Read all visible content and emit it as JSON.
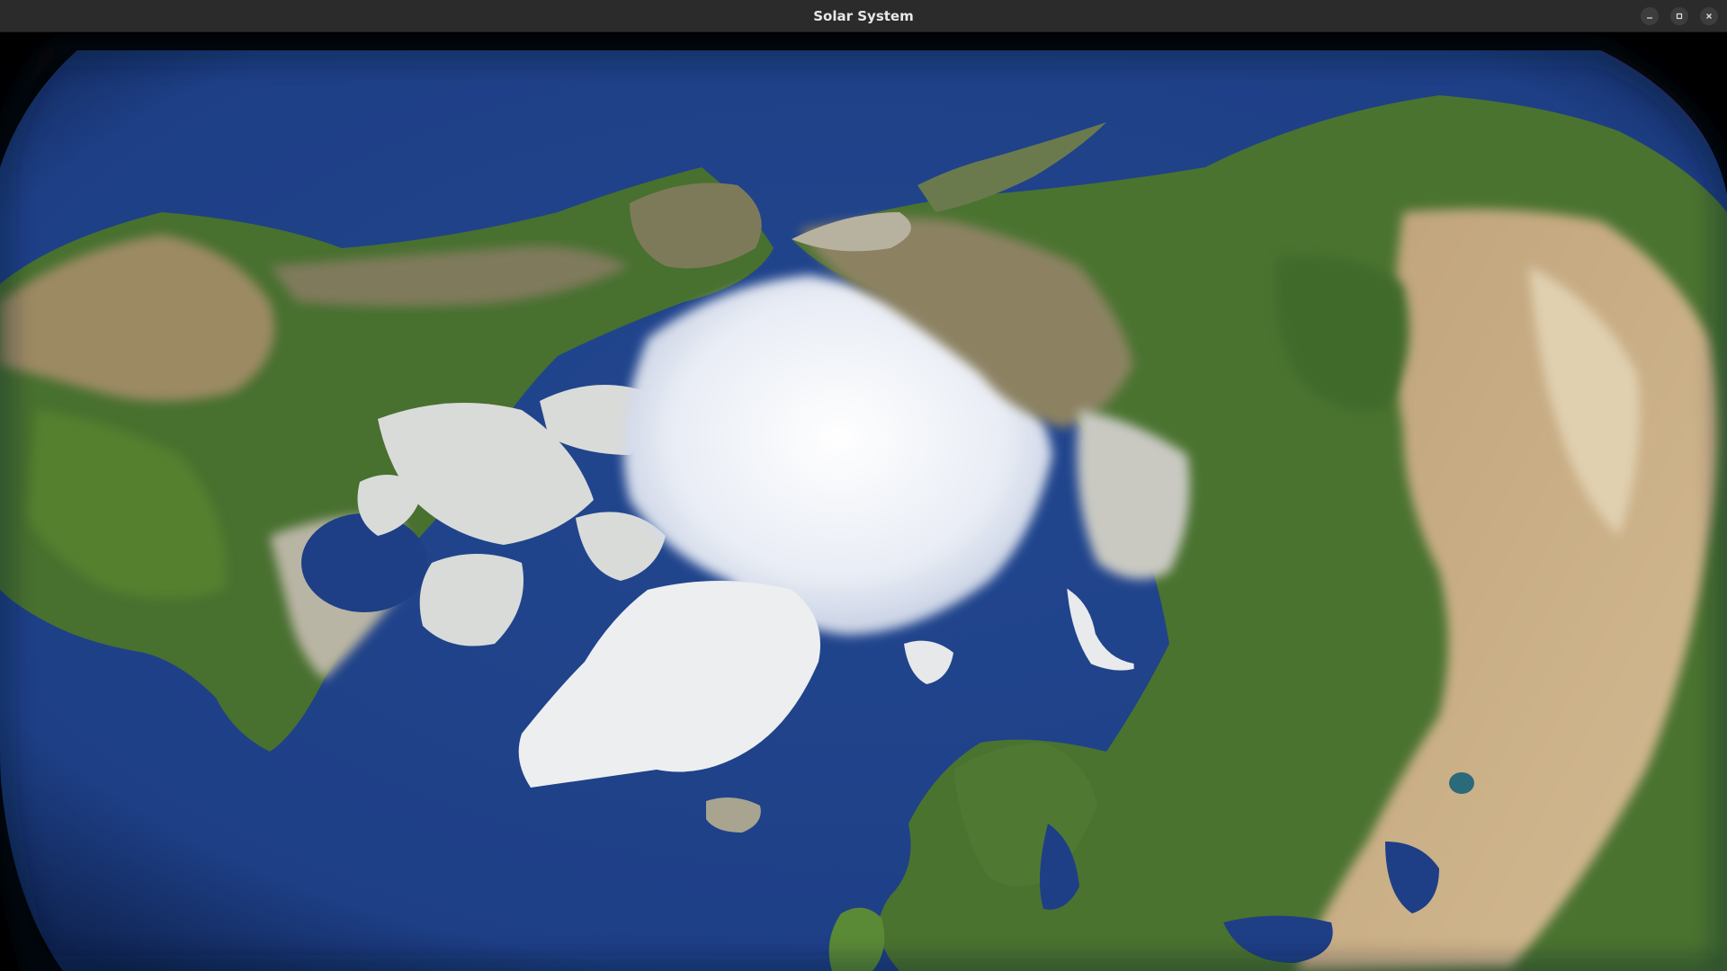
{
  "window": {
    "title": "Solar System",
    "buttons": {
      "minimize": "minimize-icon",
      "maximize": "maximize-icon",
      "close": "close-icon"
    }
  },
  "view": {
    "subject": "earth-globe",
    "colors": {
      "ocean": "#1e3f86",
      "ocean_edge": "#0f2350",
      "forest": "#3f6a2a",
      "steppe": "#8b7a55",
      "desert": "#c8ad82",
      "ice": "#f1f4f8",
      "tundra": "#b9b5a4"
    }
  }
}
